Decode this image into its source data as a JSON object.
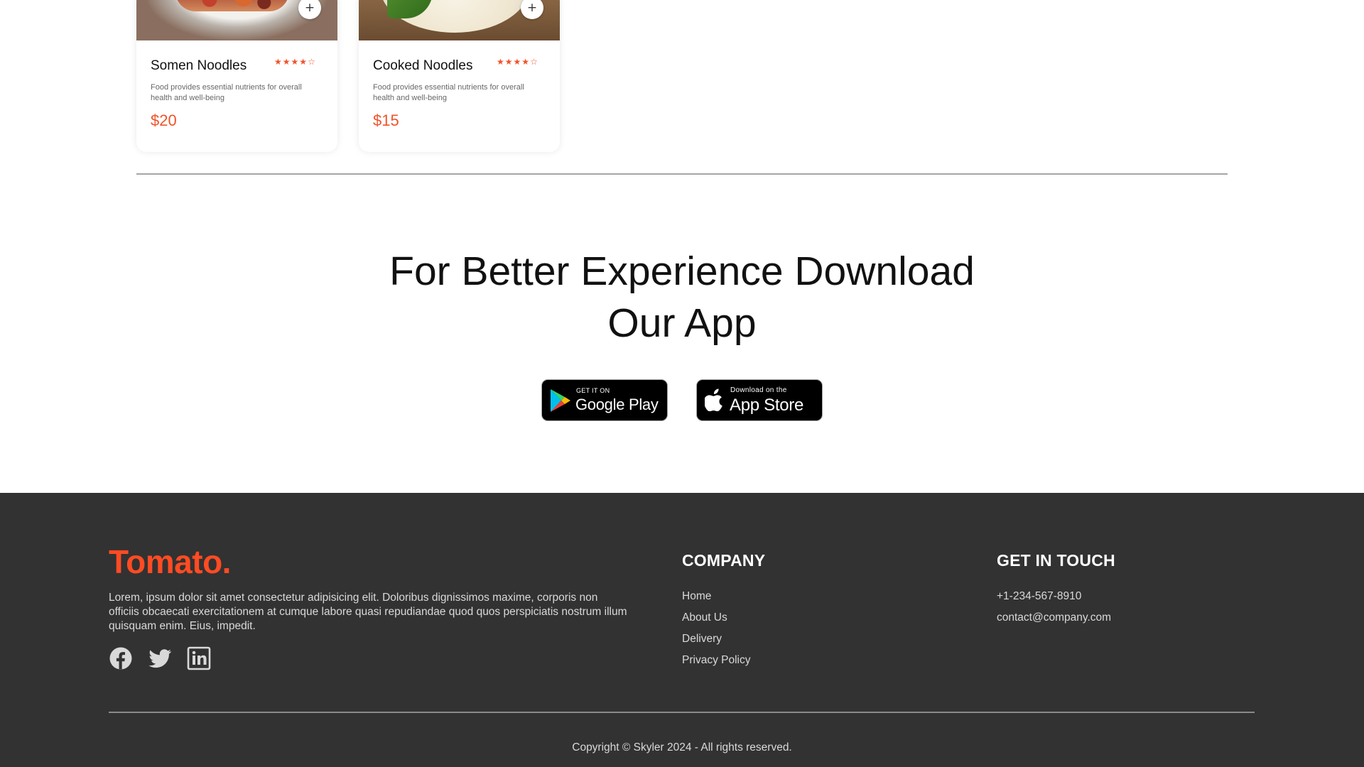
{
  "menu": {
    "items": [
      {
        "name": "Somen Noodles",
        "rating": 4,
        "rating_max": 5,
        "description": "Food provides essential nutrients for overall health and well-being",
        "price": "$20"
      },
      {
        "name": "Cooked Noodles",
        "rating": 4,
        "rating_max": 5,
        "description": "Food provides essential nutrients for overall health and well-being",
        "price": "$15"
      }
    ],
    "add_icon": "plus-icon",
    "star_icon": "star-icon"
  },
  "app_download": {
    "heading_line1": "For Better Experience Download",
    "heading_line2": "Our App",
    "google_play": {
      "small": "GET IT ON",
      "big": "Google Play"
    },
    "app_store": {
      "small": "Download on the",
      "big": "App Store"
    }
  },
  "footer": {
    "brand": "Tomato.",
    "about": "Lorem, ipsum dolor sit amet consectetur adipisicing elit. Doloribus dignissimos maxime, corporis non officiis obcaecati exercitationem at cumque labore quasi repudiandae quod quos perspiciatis nostrum illum quisquam enim. Eius, impedit.",
    "social_icons": [
      "facebook-icon",
      "twitter-icon",
      "linkedin-icon"
    ],
    "company": {
      "heading": "COMPANY",
      "links": [
        "Home",
        "About Us",
        "Delivery",
        "Privacy Policy"
      ]
    },
    "contact": {
      "heading": "GET IN TOUCH",
      "phone": "+1-234-567-8910",
      "email": "contact@company.com"
    },
    "copyright": "Copyright © Skyler 2024 - All rights reserved."
  },
  "colors": {
    "accent": "#f0532a",
    "brand": "#ff4b22",
    "footer_bg": "#323232"
  }
}
